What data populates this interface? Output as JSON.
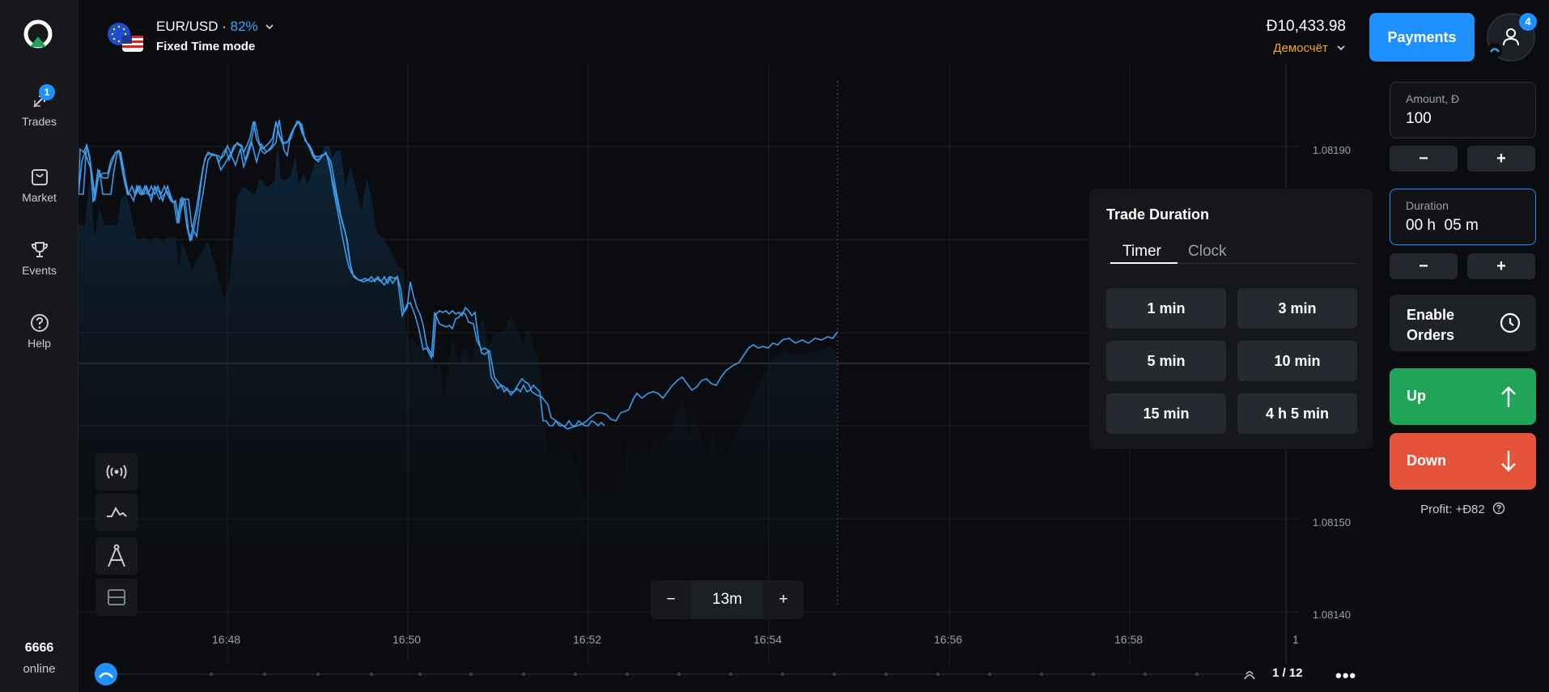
{
  "sidebar": {
    "items": [
      {
        "label": "Trades",
        "badge": "1",
        "icon": "trades-arrows-icon"
      },
      {
        "label": "Market",
        "icon": "shopping-bag-icon"
      },
      {
        "label": "Events",
        "icon": "trophy-icon"
      },
      {
        "label": "Help",
        "icon": "help-icon"
      }
    ],
    "online_count": "6666",
    "online_label": "online"
  },
  "header": {
    "asset": "EUR/USD",
    "separator": " · ",
    "payout": "82%",
    "mode": "Fixed Time mode",
    "balance": "Đ10,433.98",
    "account": "Демосчёт",
    "payments_label": "Payments",
    "notifications_count": "4"
  },
  "chart": {
    "price_labels": [
      "1.08190",
      "1.08150",
      "1.08140"
    ],
    "time_labels": [
      "16:48",
      "16:50",
      "16:52",
      "16:54",
      "16:56",
      "16:58",
      "1"
    ],
    "current_price": 1.08168,
    "line_color": "#3d9be9",
    "zoom": {
      "minus": "−",
      "value": "13m",
      "plus": "+"
    }
  },
  "trade_duration": {
    "title": "Trade Duration",
    "tabs": [
      "Timer",
      "Clock"
    ],
    "active_tab": "Timer",
    "options": [
      "1 min",
      "3 min",
      "5 min",
      "10 min",
      "15 min",
      "4 h 5 min"
    ]
  },
  "order_panel": {
    "amount_label": "Amount, Đ",
    "amount_value": "100",
    "duration_label": "Duration",
    "duration_value": "00 h  05 m",
    "minus": "−",
    "plus": "+",
    "enable_orders": "Enable Orders",
    "up_label": "Up",
    "down_label": "Down",
    "profit": "Profit: +Đ82"
  },
  "footer": {
    "pager": "1 / 12",
    "more": "•••"
  }
}
